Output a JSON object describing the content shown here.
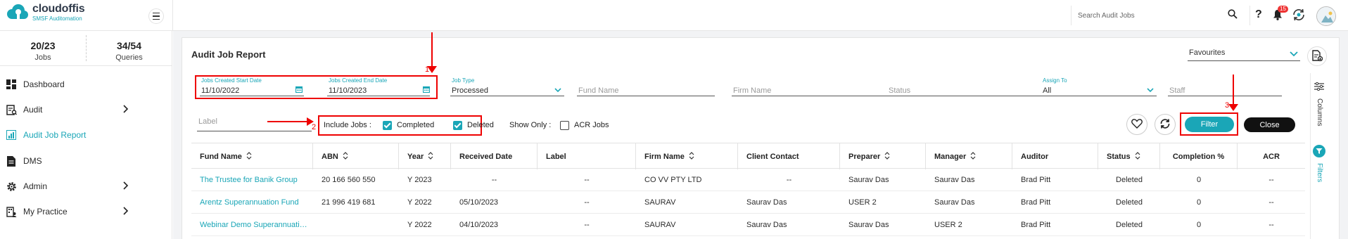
{
  "app": {
    "logo_name": "cloudoffis",
    "logo_tagline": "SMSF Auditomation"
  },
  "topbar": {
    "search_placeholder": "Search Audit Jobs",
    "help_label": "?",
    "notification_count": "15"
  },
  "sidebar": {
    "stats": [
      {
        "value": "20/23",
        "label": "Jobs"
      },
      {
        "value": "34/54",
        "label": "Queries"
      }
    ],
    "items": [
      {
        "label": "Dashboard",
        "icon": "dashboard-icon",
        "has_chevron": false,
        "active": false
      },
      {
        "label": "Audit",
        "icon": "audit-icon",
        "has_chevron": true,
        "active": false
      },
      {
        "label": "Audit Job Report",
        "icon": "report-icon",
        "has_chevron": false,
        "active": true
      },
      {
        "label": "DMS",
        "icon": "document-icon",
        "has_chevron": false,
        "active": false
      },
      {
        "label": "Admin",
        "icon": "gear-icon",
        "has_chevron": true,
        "active": false
      },
      {
        "label": "My Practice",
        "icon": "practice-icon",
        "has_chevron": true,
        "active": false
      }
    ]
  },
  "report": {
    "title": "Audit Job Report",
    "favourites_label": "Favourites",
    "filters": {
      "start_date_label": "Jobs Created Start Date",
      "start_date_value": "11/10/2022",
      "end_date_label": "Jobs Created End Date",
      "end_date_value": "11/10/2023",
      "job_type_label": "Job Type",
      "job_type_value": "Processed",
      "fund_name_placeholder": "Fund Name",
      "firm_name_placeholder": "Firm Name",
      "status_placeholder": "Status",
      "assign_to_label": "Assign To",
      "assign_to_value": "All",
      "staff_placeholder": "Staff",
      "label_placeholder": "Label",
      "include_jobs_label": "Include Jobs :",
      "completed_label": "Completed",
      "deleted_label": "Deleted",
      "show_only_label": "Show Only :",
      "acr_jobs_label": "ACR Jobs"
    },
    "buttons": {
      "filter": "Filter",
      "close": "Close"
    },
    "side_panel": {
      "columns": "Columns",
      "filters": "Filters"
    },
    "annotations": [
      "1",
      "2",
      "3"
    ]
  },
  "table": {
    "columns": [
      "Fund Name",
      "ABN",
      "Year",
      "Received Date",
      "Label",
      "Firm Name",
      "Client Contact",
      "Preparer",
      "Manager",
      "Auditor",
      "Status",
      "Completion %",
      "ACR"
    ],
    "rows": [
      [
        "The Trustee for Banik Group",
        "20 166 560 550",
        "Y 2023",
        "--",
        "--",
        "CO VV PTY LTD",
        "--",
        "Saurav Das",
        "Saurav Das",
        "Brad Pitt",
        "Deleted",
        "0",
        "--"
      ],
      [
        "Arentz Superannuation Fund",
        "21 996 419 681",
        "Y 2022",
        "05/10/2023",
        "--",
        "SAURAV",
        "Saurav Das",
        "USER 2",
        "Saurav Das",
        "Brad Pitt",
        "Deleted",
        "0",
        "--"
      ],
      [
        "Webinar Demo Superannuation Fund",
        "",
        "Y 2022",
        "04/10/2023",
        "--",
        "SAURAV",
        "Saurav Das",
        "Saurav Das",
        "USER 2",
        "Brad Pitt",
        "Deleted",
        "0",
        "--"
      ]
    ]
  },
  "colors": {
    "accent": "#1aa6b7",
    "annotation": "#e00000",
    "close_button": "#111111"
  }
}
